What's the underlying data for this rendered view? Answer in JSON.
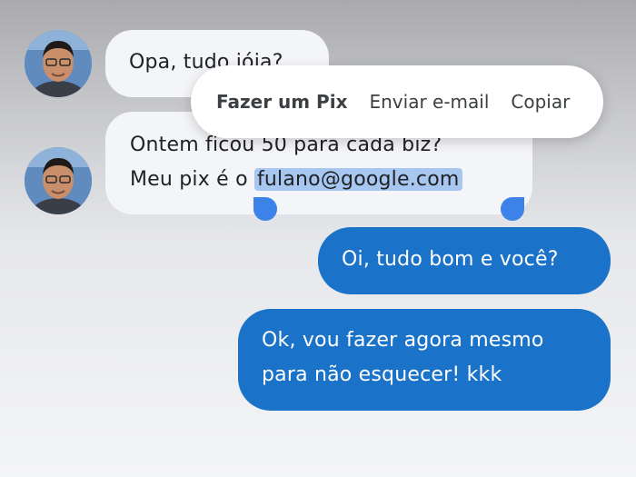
{
  "conversation": {
    "incoming": [
      {
        "avatar": "avatar-photo",
        "lines": [
          "Opa, tudo jóia?"
        ]
      },
      {
        "avatar": "avatar-photo",
        "line1": "Ontem ficou 50 para cada biz?",
        "line2_prefix": "Meu pix é o ",
        "line2_selected": "fulano@google.com"
      }
    ],
    "outgoing": [
      {
        "lines": [
          "Oi, tudo bom e você?"
        ]
      },
      {
        "lines": [
          "Ok, vou fazer agora mesmo",
          "para não esquecer! kkk"
        ]
      }
    ]
  },
  "selection_menu": {
    "items": [
      "Fazer um Pix",
      "Enviar e-mail",
      "Copiar"
    ]
  },
  "colors": {
    "outgoing_bubble": "#1a73c8",
    "incoming_bubble": "#f4f5f8",
    "selection_highlight": "#a8c7f0",
    "selection_handle": "#3d82e8"
  },
  "icons": [
    "avatar-photo",
    "selection-handle-left",
    "selection-handle-right"
  ]
}
